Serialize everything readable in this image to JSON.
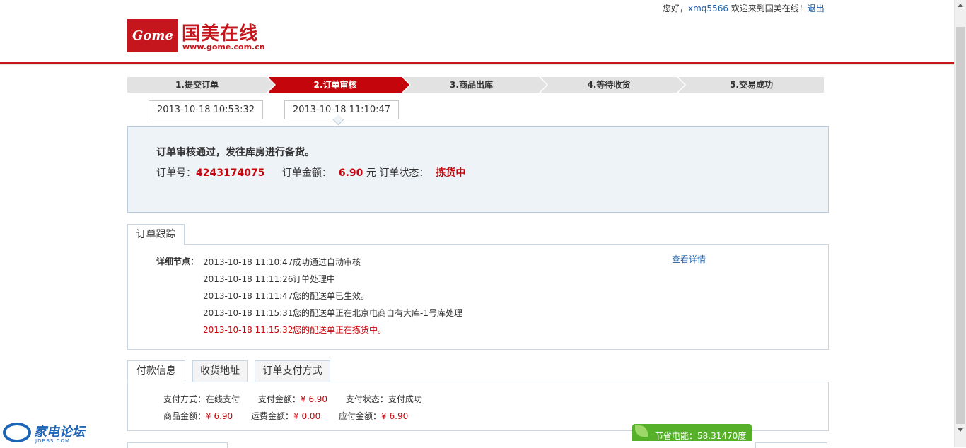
{
  "topbar": {
    "greeting": "您好，",
    "username": "xmq5566",
    "welcome": " 欢迎来到国美在线！",
    "logout": "退出"
  },
  "logo": {
    "brand": "Gome",
    "name_cn": "国美在线",
    "url": "www.gome.com.cn"
  },
  "steps": [
    {
      "label": "1.提交订单",
      "state": "done"
    },
    {
      "label": "2.订单审核",
      "state": "current"
    },
    {
      "label": "3.商品出库",
      "state": "pending"
    },
    {
      "label": "4.等待收货",
      "state": "pending"
    },
    {
      "label": "5.交易成功",
      "state": "pending"
    }
  ],
  "step_times": [
    "2013-10-18 10:53:32",
    "2013-10-18 11:10:47"
  ],
  "status": {
    "title": "订单审核通过，发往库房进行备货。",
    "order_no_label": "订单号：",
    "order_no": "4243174075",
    "amount_label": "订单金额：",
    "amount": "6.90",
    "amount_unit": "元",
    "state_label": "订单状态：",
    "state": "拣货中"
  },
  "tracking": {
    "tab": "订单跟踪",
    "node_label": "详细节点：",
    "detail_link": "查看详情",
    "rows": [
      {
        "time": "2013-10-18 11:10:47",
        "text": "成功通过自动审核"
      },
      {
        "time": "2013-10-18 11:11:26",
        "text": "订单处理中"
      },
      {
        "time": "2013-10-18 11:11:47",
        "text": "您的配送单已生效。"
      },
      {
        "time": "2013-10-18 11:15:31",
        "text": "您的配送单正在北京电商自有大库-1号库处理"
      },
      {
        "time": "2013-10-18 11:15:32",
        "text": "您的配送单正在拣货中。"
      }
    ]
  },
  "payment": {
    "tabs": [
      "付款信息",
      "收货地址",
      "订单支付方式"
    ],
    "method_label": "支付方式：",
    "method": "在线支付",
    "paid_label": "支付金额：",
    "paid": "¥ 6.90",
    "pay_state_label": "支付状态：",
    "pay_state": "支付成功",
    "goods_label": "商品金额：",
    "goods": "¥ 6.90",
    "freight_label": "运费金额：",
    "freight": "¥ 0.00",
    "due_label": "应付金额：",
    "due": "¥ 6.90"
  },
  "energy_badge": "节省电能：58.31470度",
  "watermark": {
    "name": "家电论坛",
    "url": "JDBBS.COM"
  },
  "colors": {
    "brand_red": "#c4161c",
    "link_blue": "#1a5fa8",
    "panel_bg": "#eef3f8",
    "step_inactive": "#e2e2e2"
  }
}
